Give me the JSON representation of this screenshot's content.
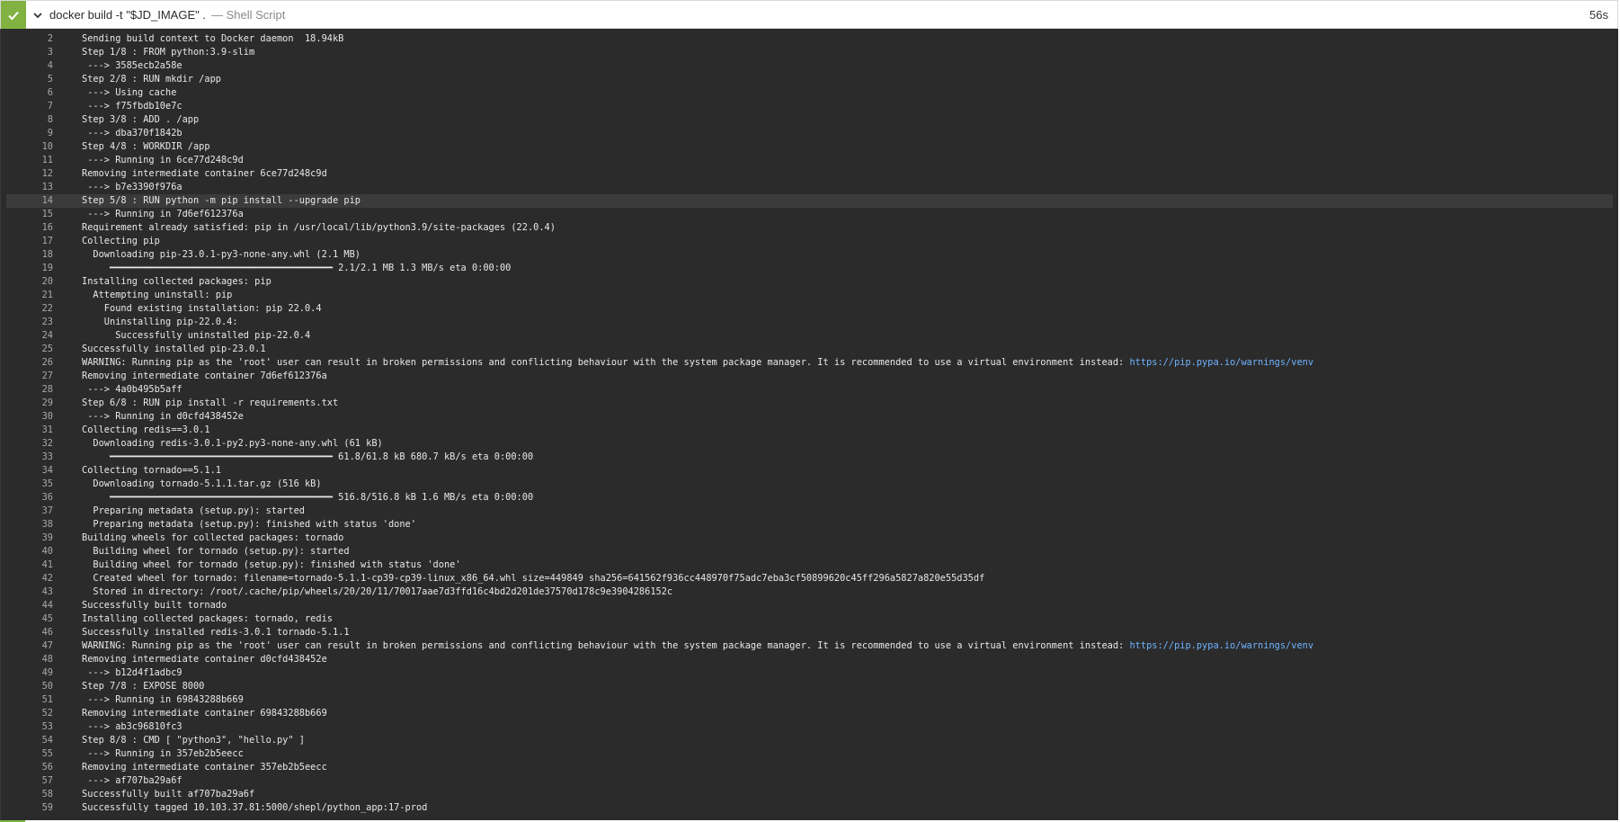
{
  "header": {
    "title": "docker build -t \"$JD_IMAGE\" .",
    "subtitle": "— Shell Script",
    "duration": "56s",
    "status": "success",
    "status_color": "#81b241",
    "icons": [
      "check-icon",
      "chevron-down-icon"
    ]
  },
  "log": {
    "highlight_line": "14",
    "link_color": "#6fb3ff",
    "lines": [
      {
        "n": "2",
        "text": "Sending build context to Docker daemon  18.94kB"
      },
      {
        "n": "3",
        "text": "Step 1/8 : FROM python:3.9-slim"
      },
      {
        "n": "4",
        "text": " ---> 3585ecb2a58e"
      },
      {
        "n": "5",
        "text": "Step 2/8 : RUN mkdir /app"
      },
      {
        "n": "6",
        "text": " ---> Using cache"
      },
      {
        "n": "7",
        "text": " ---> f75fbdb10e7c"
      },
      {
        "n": "8",
        "text": "Step 3/8 : ADD . /app"
      },
      {
        "n": "9",
        "text": " ---> dba370f1842b"
      },
      {
        "n": "10",
        "text": "Step 4/8 : WORKDIR /app"
      },
      {
        "n": "11",
        "text": " ---> Running in 6ce77d248c9d"
      },
      {
        "n": "12",
        "text": "Removing intermediate container 6ce77d248c9d"
      },
      {
        "n": "13",
        "text": " ---> b7e3390f976a"
      },
      {
        "n": "14",
        "text": "Step 5/8 : RUN python -m pip install --upgrade pip"
      },
      {
        "n": "15",
        "text": " ---> Running in 7d6ef612376a"
      },
      {
        "n": "16",
        "text": "Requirement already satisfied: pip in /usr/local/lib/python3.9/site-packages (22.0.4)"
      },
      {
        "n": "17",
        "text": "Collecting pip"
      },
      {
        "n": "18",
        "text": "  Downloading pip-23.0.1-py3-none-any.whl (2.1 MB)"
      },
      {
        "n": "19",
        "text": "     ━━━━━━━━━━━━━━━━━━━━━━━━━━━━━━━━━━━━━━━━ 2.1/2.1 MB 1.3 MB/s eta 0:00:00"
      },
      {
        "n": "20",
        "text": "Installing collected packages: pip"
      },
      {
        "n": "21",
        "text": "  Attempting uninstall: pip"
      },
      {
        "n": "22",
        "text": "    Found existing installation: pip 22.0.4"
      },
      {
        "n": "23",
        "text": "    Uninstalling pip-22.0.4:"
      },
      {
        "n": "24",
        "text": "      Successfully uninstalled pip-22.0.4"
      },
      {
        "n": "25",
        "text": "Successfully installed pip-23.0.1"
      },
      {
        "n": "26",
        "text": "WARNING: Running pip as the 'root' user can result in broken permissions and conflicting behaviour with the system package manager. It is recommended to use a virtual environment instead: ",
        "link": "https://pip.pypa.io/warnings/venv"
      },
      {
        "n": "27",
        "text": "Removing intermediate container 7d6ef612376a"
      },
      {
        "n": "28",
        "text": " ---> 4a0b495b5aff"
      },
      {
        "n": "29",
        "text": "Step 6/8 : RUN pip install -r requirements.txt"
      },
      {
        "n": "30",
        "text": " ---> Running in d0cfd438452e"
      },
      {
        "n": "31",
        "text": "Collecting redis==3.0.1"
      },
      {
        "n": "32",
        "text": "  Downloading redis-3.0.1-py2.py3-none-any.whl (61 kB)"
      },
      {
        "n": "33",
        "text": "     ━━━━━━━━━━━━━━━━━━━━━━━━━━━━━━━━━━━━━━━━ 61.8/61.8 kB 680.7 kB/s eta 0:00:00"
      },
      {
        "n": "34",
        "text": "Collecting tornado==5.1.1"
      },
      {
        "n": "35",
        "text": "  Downloading tornado-5.1.1.tar.gz (516 kB)"
      },
      {
        "n": "36",
        "text": "     ━━━━━━━━━━━━━━━━━━━━━━━━━━━━━━━━━━━━━━━━ 516.8/516.8 kB 1.6 MB/s eta 0:00:00"
      },
      {
        "n": "37",
        "text": "  Preparing metadata (setup.py): started"
      },
      {
        "n": "38",
        "text": "  Preparing metadata (setup.py): finished with status 'done'"
      },
      {
        "n": "39",
        "text": "Building wheels for collected packages: tornado"
      },
      {
        "n": "40",
        "text": "  Building wheel for tornado (setup.py): started"
      },
      {
        "n": "41",
        "text": "  Building wheel for tornado (setup.py): finished with status 'done'"
      },
      {
        "n": "42",
        "text": "  Created wheel for tornado: filename=tornado-5.1.1-cp39-cp39-linux_x86_64.whl size=449849 sha256=641562f936cc448970f75adc7eba3cf50899620c45ff296a5827a820e55d35df"
      },
      {
        "n": "43",
        "text": "  Stored in directory: /root/.cache/pip/wheels/20/20/11/70017aae7d3ffd16c4bd2d201de37570d178c9e3904286152c"
      },
      {
        "n": "44",
        "text": "Successfully built tornado"
      },
      {
        "n": "45",
        "text": "Installing collected packages: tornado, redis"
      },
      {
        "n": "46",
        "text": "Successfully installed redis-3.0.1 tornado-5.1.1"
      },
      {
        "n": "47",
        "text": "WARNING: Running pip as the 'root' user can result in broken permissions and conflicting behaviour with the system package manager. It is recommended to use a virtual environment instead: ",
        "link": "https://pip.pypa.io/warnings/venv"
      },
      {
        "n": "48",
        "text": "Removing intermediate container d0cfd438452e"
      },
      {
        "n": "49",
        "text": " ---> b12d4f1adbc9"
      },
      {
        "n": "50",
        "text": "Step 7/8 : EXPOSE 8000"
      },
      {
        "n": "51",
        "text": " ---> Running in 69843288b669"
      },
      {
        "n": "52",
        "text": "Removing intermediate container 69843288b669"
      },
      {
        "n": "53",
        "text": " ---> ab3c96810fc3"
      },
      {
        "n": "54",
        "text": "Step 8/8 : CMD [ \"python3\", \"hello.py\" ]"
      },
      {
        "n": "55",
        "text": " ---> Running in 357eb2b5eecc"
      },
      {
        "n": "56",
        "text": "Removing intermediate container 357eb2b5eecc"
      },
      {
        "n": "57",
        "text": " ---> af707ba29a6f"
      },
      {
        "n": "58",
        "text": "Successfully built af707ba29a6f"
      },
      {
        "n": "59",
        "text": "Successfully tagged 10.103.37.81:5000/shepl/python_app:17-prod"
      }
    ]
  }
}
